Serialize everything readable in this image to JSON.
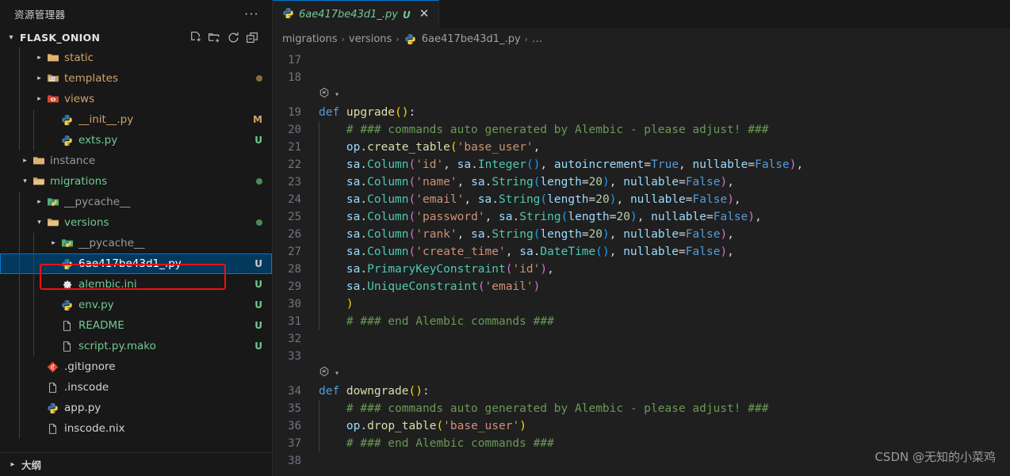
{
  "sidebar": {
    "title": "资源管理器",
    "more_label": "···",
    "root": {
      "name": "FLASK_ONION",
      "chevron": "chevron-down",
      "actions": [
        {
          "name": "new-file-icon",
          "tooltip": "新建文件"
        },
        {
          "name": "new-folder-icon",
          "tooltip": "新建文件夹"
        },
        {
          "name": "refresh-icon",
          "tooltip": "刷新资源管理器"
        },
        {
          "name": "collapse-all-icon",
          "tooltip": "在资源管理器中折叠文件夹"
        }
      ]
    },
    "tree": [
      {
        "label": "static",
        "icon": "folder-icon",
        "indent": 2,
        "chevron": "right",
        "badge": "",
        "badge_color": "",
        "color": "#cfa36a",
        "dot": ""
      },
      {
        "label": "templates",
        "icon": "folder-templates-icon",
        "indent": 2,
        "chevron": "right",
        "badge": "",
        "badge_color": "",
        "color": "#cfa36a",
        "dot": "#8a6d3f"
      },
      {
        "label": "views",
        "icon": "folder-views-icon",
        "indent": 2,
        "chevron": "right",
        "badge": "",
        "badge_color": "",
        "color": "#cfa36a",
        "dot": ""
      },
      {
        "label": "__init__.py",
        "icon": "python-icon",
        "indent": 3,
        "chevron": "",
        "badge": "M",
        "badge_color": "#cfa36a",
        "color": "#cfa36a",
        "dot": ""
      },
      {
        "label": "exts.py",
        "icon": "python-icon",
        "indent": 3,
        "chevron": "",
        "badge": "U",
        "badge_color": "#73c991",
        "color": "#73c991",
        "dot": ""
      },
      {
        "label": "instance",
        "icon": "folder-icon",
        "indent": 1,
        "chevron": "right",
        "badge": "",
        "badge_color": "",
        "color": "#9a9a9a",
        "dot": ""
      },
      {
        "label": "migrations",
        "icon": "folder-open-icon",
        "indent": 1,
        "chevron": "down",
        "badge": "",
        "badge_color": "",
        "color": "#73c991",
        "dot": "#4a8a58"
      },
      {
        "label": "__pycache__",
        "icon": "folder-python-icon",
        "indent": 2,
        "chevron": "right",
        "badge": "",
        "badge_color": "",
        "color": "#9a9a9a",
        "dot": ""
      },
      {
        "label": "versions",
        "icon": "folder-open-icon",
        "indent": 2,
        "chevron": "down",
        "badge": "",
        "badge_color": "",
        "color": "#73c991",
        "dot": "#4a8a58"
      },
      {
        "label": "__pycache__",
        "icon": "folder-python-icon",
        "indent": 3,
        "chevron": "right",
        "badge": "",
        "badge_color": "",
        "color": "#9a9a9a",
        "dot": ""
      },
      {
        "label": "6ae417be43d1_.py",
        "icon": "python-icon",
        "indent": 3,
        "chevron": "",
        "badge": "U",
        "badge_color": "#cccccc",
        "color": "#ffffff",
        "dot": "",
        "selected": true
      },
      {
        "label": "alembic.ini",
        "icon": "gear-icon",
        "indent": 3,
        "chevron": "",
        "badge": "U",
        "badge_color": "#73c991",
        "color": "#73c991",
        "dot": ""
      },
      {
        "label": "env.py",
        "icon": "python-icon",
        "indent": 3,
        "chevron": "",
        "badge": "U",
        "badge_color": "#73c991",
        "color": "#73c991",
        "dot": ""
      },
      {
        "label": "README",
        "icon": "file-icon",
        "indent": 3,
        "chevron": "",
        "badge": "U",
        "badge_color": "#73c991",
        "color": "#73c991",
        "dot": ""
      },
      {
        "label": "script.py.mako",
        "icon": "file-icon",
        "indent": 3,
        "chevron": "",
        "badge": "U",
        "badge_color": "#73c991",
        "color": "#73c991",
        "dot": ""
      },
      {
        "label": ".gitignore",
        "icon": "git-icon",
        "indent": 2,
        "chevron": "",
        "badge": "",
        "badge_color": "",
        "color": "#d4d4d4",
        "dot": ""
      },
      {
        "label": ".inscode",
        "icon": "file-icon",
        "indent": 2,
        "chevron": "",
        "badge": "",
        "badge_color": "",
        "color": "#d4d4d4",
        "dot": ""
      },
      {
        "label": "app.py",
        "icon": "python-icon",
        "indent": 2,
        "chevron": "",
        "badge": "",
        "badge_color": "",
        "color": "#d4d4d4",
        "dot": ""
      },
      {
        "label": "inscode.nix",
        "icon": "file-icon",
        "indent": 2,
        "chevron": "",
        "badge": "",
        "badge_color": "",
        "color": "#d4d4d4",
        "dot": ""
      }
    ],
    "outline": {
      "label": "大纲",
      "chevron": "right"
    }
  },
  "editor": {
    "tab": {
      "filename": "6ae417be43d1_.py",
      "status": "U",
      "close_label": "✕",
      "icon": "python-icon"
    },
    "breadcrumb": [
      {
        "label": "migrations",
        "icon": ""
      },
      {
        "label": "versions",
        "icon": ""
      },
      {
        "label": "6ae417be43d1_.py",
        "icon": "python-icon"
      },
      {
        "label": "…",
        "icon": ""
      }
    ],
    "breadcrumb_separator": "›",
    "lines": [
      {
        "n": "17",
        "tokens": []
      },
      {
        "n": "18",
        "tokens": []
      },
      {
        "n": "",
        "lens": true,
        "tokens": []
      },
      {
        "n": "19",
        "tokens": [
          {
            "t": "def ",
            "c": "t-kw"
          },
          {
            "t": "upgrade",
            "c": "t-fn"
          },
          {
            "t": "(",
            "c": "t-p1"
          },
          {
            "t": ")",
            "c": "t-p1"
          },
          {
            "t": ":",
            "c": "t-op"
          }
        ]
      },
      {
        "n": "20",
        "guide": true,
        "tokens": [
          {
            "t": "    # ### commands auto generated by Alembic - please adjust! ###",
            "c": "t-com"
          }
        ]
      },
      {
        "n": "21",
        "guide": true,
        "tokens": [
          {
            "t": "    op",
            "c": "t-var"
          },
          {
            "t": ".",
            "c": "t-op"
          },
          {
            "t": "create_table",
            "c": "t-fn"
          },
          {
            "t": "(",
            "c": "t-p1"
          },
          {
            "t": "'base_user'",
            "c": "t-str"
          },
          {
            "t": ",",
            "c": "t-op"
          }
        ]
      },
      {
        "n": "22",
        "guide": true,
        "tokens": [
          {
            "t": "    sa",
            "c": "t-var"
          },
          {
            "t": ".",
            "c": "t-op"
          },
          {
            "t": "Column",
            "c": "t-cls"
          },
          {
            "t": "(",
            "c": "t-p2"
          },
          {
            "t": "'id'",
            "c": "t-str"
          },
          {
            "t": ", ",
            "c": "t-op"
          },
          {
            "t": "sa",
            "c": "t-var"
          },
          {
            "t": ".",
            "c": "t-op"
          },
          {
            "t": "Integer",
            "c": "t-cls"
          },
          {
            "t": "(",
            "c": "t-p3"
          },
          {
            "t": ")",
            "c": "t-p3"
          },
          {
            "t": ", ",
            "c": "t-op"
          },
          {
            "t": "autoincrement",
            "c": "t-var"
          },
          {
            "t": "=",
            "c": "t-op"
          },
          {
            "t": "True",
            "c": "t-const"
          },
          {
            "t": ", ",
            "c": "t-op"
          },
          {
            "t": "nullable",
            "c": "t-var"
          },
          {
            "t": "=",
            "c": "t-op"
          },
          {
            "t": "False",
            "c": "t-const"
          },
          {
            "t": ")",
            "c": "t-p2"
          },
          {
            "t": ",",
            "c": "t-op"
          }
        ]
      },
      {
        "n": "23",
        "guide": true,
        "tokens": [
          {
            "t": "    sa",
            "c": "t-var"
          },
          {
            "t": ".",
            "c": "t-op"
          },
          {
            "t": "Column",
            "c": "t-cls"
          },
          {
            "t": "(",
            "c": "t-p2"
          },
          {
            "t": "'name'",
            "c": "t-str"
          },
          {
            "t": ", ",
            "c": "t-op"
          },
          {
            "t": "sa",
            "c": "t-var"
          },
          {
            "t": ".",
            "c": "t-op"
          },
          {
            "t": "String",
            "c": "t-cls"
          },
          {
            "t": "(",
            "c": "t-p3"
          },
          {
            "t": "length",
            "c": "t-var"
          },
          {
            "t": "=",
            "c": "t-op"
          },
          {
            "t": "20",
            "c": "t-num"
          },
          {
            "t": ")",
            "c": "t-p3"
          },
          {
            "t": ", ",
            "c": "t-op"
          },
          {
            "t": "nullable",
            "c": "t-var"
          },
          {
            "t": "=",
            "c": "t-op"
          },
          {
            "t": "False",
            "c": "t-const"
          },
          {
            "t": ")",
            "c": "t-p2"
          },
          {
            "t": ",",
            "c": "t-op"
          }
        ]
      },
      {
        "n": "24",
        "guide": true,
        "tokens": [
          {
            "t": "    sa",
            "c": "t-var"
          },
          {
            "t": ".",
            "c": "t-op"
          },
          {
            "t": "Column",
            "c": "t-cls"
          },
          {
            "t": "(",
            "c": "t-p2"
          },
          {
            "t": "'email'",
            "c": "t-str"
          },
          {
            "t": ", ",
            "c": "t-op"
          },
          {
            "t": "sa",
            "c": "t-var"
          },
          {
            "t": ".",
            "c": "t-op"
          },
          {
            "t": "String",
            "c": "t-cls"
          },
          {
            "t": "(",
            "c": "t-p3"
          },
          {
            "t": "length",
            "c": "t-var"
          },
          {
            "t": "=",
            "c": "t-op"
          },
          {
            "t": "20",
            "c": "t-num"
          },
          {
            "t": ")",
            "c": "t-p3"
          },
          {
            "t": ", ",
            "c": "t-op"
          },
          {
            "t": "nullable",
            "c": "t-var"
          },
          {
            "t": "=",
            "c": "t-op"
          },
          {
            "t": "False",
            "c": "t-const"
          },
          {
            "t": ")",
            "c": "t-p2"
          },
          {
            "t": ",",
            "c": "t-op"
          }
        ]
      },
      {
        "n": "25",
        "guide": true,
        "tokens": [
          {
            "t": "    sa",
            "c": "t-var"
          },
          {
            "t": ".",
            "c": "t-op"
          },
          {
            "t": "Column",
            "c": "t-cls"
          },
          {
            "t": "(",
            "c": "t-p2"
          },
          {
            "t": "'password'",
            "c": "t-str"
          },
          {
            "t": ", ",
            "c": "t-op"
          },
          {
            "t": "sa",
            "c": "t-var"
          },
          {
            "t": ".",
            "c": "t-op"
          },
          {
            "t": "String",
            "c": "t-cls"
          },
          {
            "t": "(",
            "c": "t-p3"
          },
          {
            "t": "length",
            "c": "t-var"
          },
          {
            "t": "=",
            "c": "t-op"
          },
          {
            "t": "20",
            "c": "t-num"
          },
          {
            "t": ")",
            "c": "t-p3"
          },
          {
            "t": ", ",
            "c": "t-op"
          },
          {
            "t": "nullable",
            "c": "t-var"
          },
          {
            "t": "=",
            "c": "t-op"
          },
          {
            "t": "False",
            "c": "t-const"
          },
          {
            "t": ")",
            "c": "t-p2"
          },
          {
            "t": ",",
            "c": "t-op"
          }
        ]
      },
      {
        "n": "26",
        "guide": true,
        "tokens": [
          {
            "t": "    sa",
            "c": "t-var"
          },
          {
            "t": ".",
            "c": "t-op"
          },
          {
            "t": "Column",
            "c": "t-cls"
          },
          {
            "t": "(",
            "c": "t-p2"
          },
          {
            "t": "'rank'",
            "c": "t-str"
          },
          {
            "t": ", ",
            "c": "t-op"
          },
          {
            "t": "sa",
            "c": "t-var"
          },
          {
            "t": ".",
            "c": "t-op"
          },
          {
            "t": "String",
            "c": "t-cls"
          },
          {
            "t": "(",
            "c": "t-p3"
          },
          {
            "t": "length",
            "c": "t-var"
          },
          {
            "t": "=",
            "c": "t-op"
          },
          {
            "t": "20",
            "c": "t-num"
          },
          {
            "t": ")",
            "c": "t-p3"
          },
          {
            "t": ", ",
            "c": "t-op"
          },
          {
            "t": "nullable",
            "c": "t-var"
          },
          {
            "t": "=",
            "c": "t-op"
          },
          {
            "t": "False",
            "c": "t-const"
          },
          {
            "t": ")",
            "c": "t-p2"
          },
          {
            "t": ",",
            "c": "t-op"
          }
        ]
      },
      {
        "n": "27",
        "guide": true,
        "tokens": [
          {
            "t": "    sa",
            "c": "t-var"
          },
          {
            "t": ".",
            "c": "t-op"
          },
          {
            "t": "Column",
            "c": "t-cls"
          },
          {
            "t": "(",
            "c": "t-p2"
          },
          {
            "t": "'create_time'",
            "c": "t-str"
          },
          {
            "t": ", ",
            "c": "t-op"
          },
          {
            "t": "sa",
            "c": "t-var"
          },
          {
            "t": ".",
            "c": "t-op"
          },
          {
            "t": "DateTime",
            "c": "t-cls"
          },
          {
            "t": "(",
            "c": "t-p3"
          },
          {
            "t": ")",
            "c": "t-p3"
          },
          {
            "t": ", ",
            "c": "t-op"
          },
          {
            "t": "nullable",
            "c": "t-var"
          },
          {
            "t": "=",
            "c": "t-op"
          },
          {
            "t": "False",
            "c": "t-const"
          },
          {
            "t": ")",
            "c": "t-p2"
          },
          {
            "t": ",",
            "c": "t-op"
          }
        ]
      },
      {
        "n": "28",
        "guide": true,
        "tokens": [
          {
            "t": "    sa",
            "c": "t-var"
          },
          {
            "t": ".",
            "c": "t-op"
          },
          {
            "t": "PrimaryKeyConstraint",
            "c": "t-cls"
          },
          {
            "t": "(",
            "c": "t-p2"
          },
          {
            "t": "'id'",
            "c": "t-str"
          },
          {
            "t": ")",
            "c": "t-p2"
          },
          {
            "t": ",",
            "c": "t-op"
          }
        ]
      },
      {
        "n": "29",
        "guide": true,
        "tokens": [
          {
            "t": "    sa",
            "c": "t-var"
          },
          {
            "t": ".",
            "c": "t-op"
          },
          {
            "t": "UniqueConstraint",
            "c": "t-cls"
          },
          {
            "t": "(",
            "c": "t-p2"
          },
          {
            "t": "'email'",
            "c": "t-str"
          },
          {
            "t": ")",
            "c": "t-p2"
          }
        ]
      },
      {
        "n": "30",
        "guide": true,
        "tokens": [
          {
            "t": "    ",
            "c": "t-op"
          },
          {
            "t": ")",
            "c": "t-p1"
          }
        ]
      },
      {
        "n": "31",
        "guide": true,
        "tokens": [
          {
            "t": "    # ### end Alembic commands ###",
            "c": "t-com"
          }
        ]
      },
      {
        "n": "32",
        "tokens": []
      },
      {
        "n": "33",
        "tokens": []
      },
      {
        "n": "",
        "lens": true,
        "tokens": []
      },
      {
        "n": "34",
        "tokens": [
          {
            "t": "def ",
            "c": "t-kw"
          },
          {
            "t": "downgrade",
            "c": "t-fn"
          },
          {
            "t": "(",
            "c": "t-p1"
          },
          {
            "t": ")",
            "c": "t-p1"
          },
          {
            "t": ":",
            "c": "t-op"
          }
        ]
      },
      {
        "n": "35",
        "guide": true,
        "tokens": [
          {
            "t": "    # ### commands auto generated by Alembic - please adjust! ###",
            "c": "t-com"
          }
        ]
      },
      {
        "n": "36",
        "guide": true,
        "tokens": [
          {
            "t": "    op",
            "c": "t-var"
          },
          {
            "t": ".",
            "c": "t-op"
          },
          {
            "t": "drop_table",
            "c": "t-fn"
          },
          {
            "t": "(",
            "c": "t-p1"
          },
          {
            "t": "'base_user'",
            "c": "t-str"
          },
          {
            "t": ")",
            "c": "t-p1"
          }
        ]
      },
      {
        "n": "37",
        "guide": true,
        "tokens": [
          {
            "t": "    # ### end Alembic commands ###",
            "c": "t-com"
          }
        ]
      },
      {
        "n": "38",
        "tokens": []
      }
    ]
  },
  "watermark": {
    "text": "CSDN @无知的小菜鸡"
  },
  "colors": {
    "accent": "#0078d4",
    "selection": "#04395e",
    "annotation": "#ee1111",
    "editor_bg": "#1f1f1f",
    "sidebar_bg": "#181818",
    "untracked": "#73c991",
    "modified": "#cfa36a"
  }
}
